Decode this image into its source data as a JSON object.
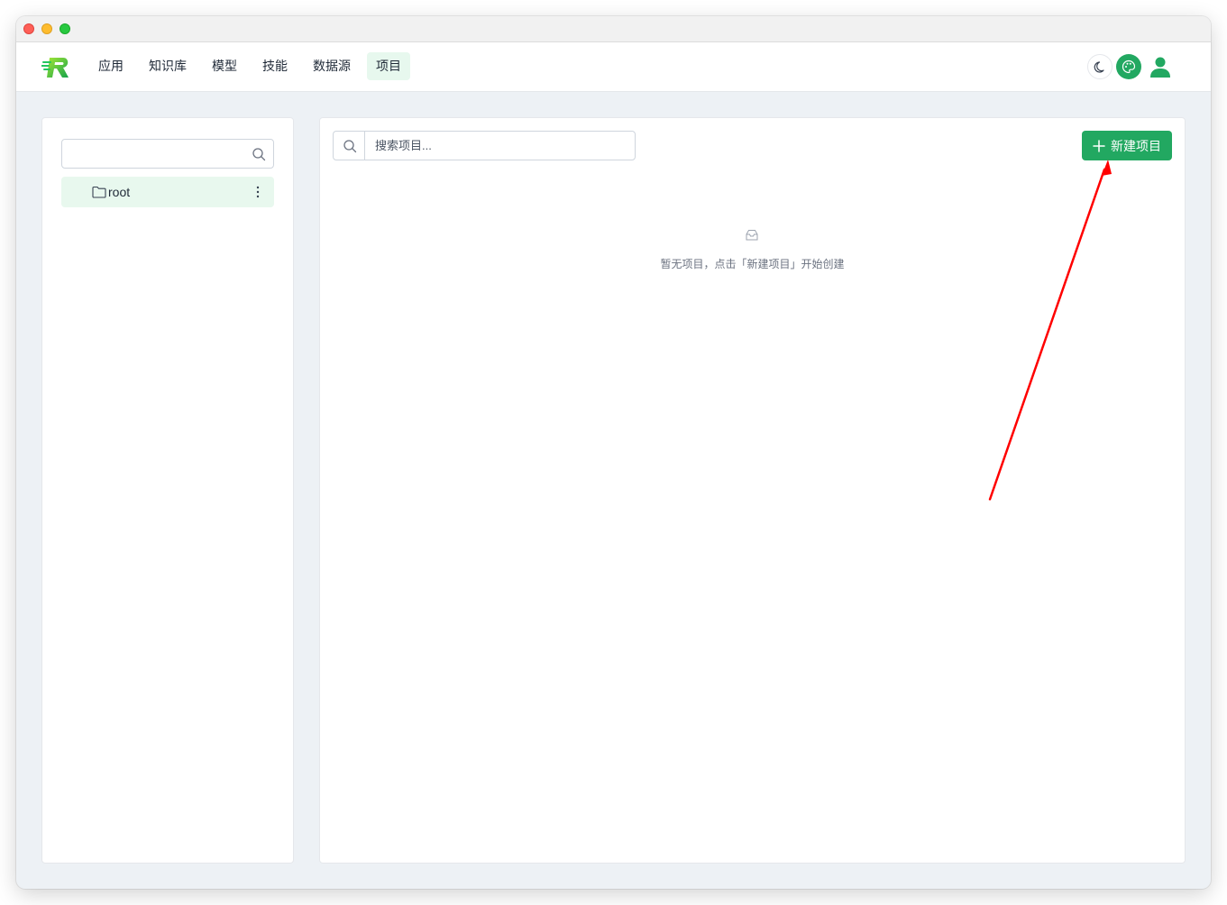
{
  "nav": {
    "items": [
      {
        "label": "应用"
      },
      {
        "label": "知识库"
      },
      {
        "label": "模型"
      },
      {
        "label": "技能"
      },
      {
        "label": "数据源"
      },
      {
        "label": "项目",
        "active": true
      }
    ],
    "icons": [
      "moon-icon",
      "palette-icon",
      "user-icon"
    ]
  },
  "sidebar": {
    "search_value": "",
    "tree": [
      {
        "label": "root",
        "icon": "folder-icon"
      }
    ]
  },
  "main": {
    "search_placeholder": "搜索项目...",
    "new_button_label": "新建项目",
    "empty_text": "暂无项目，点击「新建项目」开始创建"
  },
  "colors": {
    "accent": "#22a861",
    "active_bg": "#e7f8ee",
    "annotation": "#ff0000"
  }
}
